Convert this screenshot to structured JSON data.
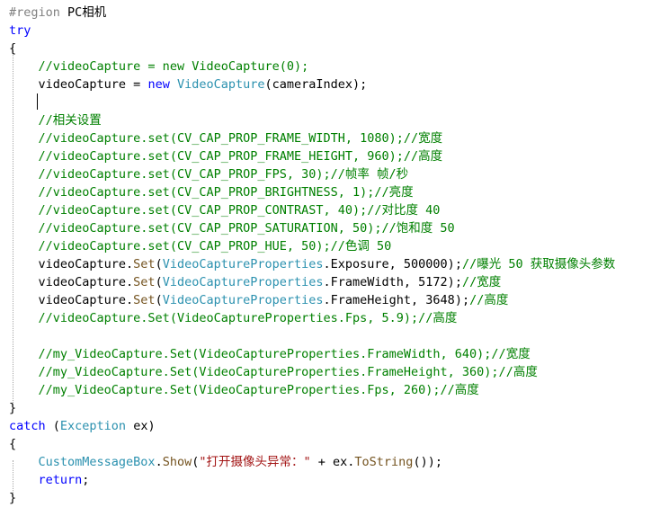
{
  "editor": {
    "lines": [
      [
        {
          "t": "#region ",
          "c": "directive"
        },
        {
          "t": "PC相机",
          "c": "plain"
        }
      ],
      [
        {
          "t": "try",
          "c": "kw"
        }
      ],
      [
        {
          "t": "{",
          "c": "plain"
        }
      ],
      [
        {
          "t": "    ",
          "c": "plain"
        },
        {
          "t": "//videoCapture = new VideoCapture(0);",
          "c": "comment"
        }
      ],
      [
        {
          "t": "    videoCapture = ",
          "c": "plain"
        },
        {
          "t": "new",
          "c": "kw"
        },
        {
          "t": " ",
          "c": "plain"
        },
        {
          "t": "VideoCapture",
          "c": "type"
        },
        {
          "t": "(cameraIndex);",
          "c": "plain"
        }
      ],
      [
        {
          "t": "",
          "c": "plain"
        }
      ],
      [
        {
          "t": "    ",
          "c": "plain"
        },
        {
          "t": "//相关设置",
          "c": "comment"
        }
      ],
      [
        {
          "t": "    ",
          "c": "plain"
        },
        {
          "t": "//videoCapture.set(CV_CAP_PROP_FRAME_WIDTH, 1080);//宽度",
          "c": "comment"
        }
      ],
      [
        {
          "t": "    ",
          "c": "plain"
        },
        {
          "t": "//videoCapture.set(CV_CAP_PROP_FRAME_HEIGHT, 960);//高度",
          "c": "comment"
        }
      ],
      [
        {
          "t": "    ",
          "c": "plain"
        },
        {
          "t": "//videoCapture.set(CV_CAP_PROP_FPS, 30);//帧率 帧/秒",
          "c": "comment"
        }
      ],
      [
        {
          "t": "    ",
          "c": "plain"
        },
        {
          "t": "//videoCapture.set(CV_CAP_PROP_BRIGHTNESS, 1);//亮度",
          "c": "comment"
        }
      ],
      [
        {
          "t": "    ",
          "c": "plain"
        },
        {
          "t": "//videoCapture.set(CV_CAP_PROP_CONTRAST, 40);//对比度 40",
          "c": "comment"
        }
      ],
      [
        {
          "t": "    ",
          "c": "plain"
        },
        {
          "t": "//videoCapture.set(CV_CAP_PROP_SATURATION, 50);//饱和度 50",
          "c": "comment"
        }
      ],
      [
        {
          "t": "    ",
          "c": "plain"
        },
        {
          "t": "//videoCapture.set(CV_CAP_PROP_HUE, 50);//色调 50",
          "c": "comment"
        }
      ],
      [
        {
          "t": "    videoCapture.",
          "c": "plain"
        },
        {
          "t": "Set",
          "c": "method"
        },
        {
          "t": "(",
          "c": "plain"
        },
        {
          "t": "VideoCaptureProperties",
          "c": "type"
        },
        {
          "t": ".Exposure, 500000);",
          "c": "plain"
        },
        {
          "t": "//曝光 50 获取摄像头参数",
          "c": "comment"
        }
      ],
      [
        {
          "t": "    videoCapture.",
          "c": "plain"
        },
        {
          "t": "Set",
          "c": "method"
        },
        {
          "t": "(",
          "c": "plain"
        },
        {
          "t": "VideoCaptureProperties",
          "c": "type"
        },
        {
          "t": ".FrameWidth, 5172);",
          "c": "plain"
        },
        {
          "t": "//宽度",
          "c": "comment"
        }
      ],
      [
        {
          "t": "    videoCapture.",
          "c": "plain"
        },
        {
          "t": "Set",
          "c": "method"
        },
        {
          "t": "(",
          "c": "plain"
        },
        {
          "t": "VideoCaptureProperties",
          "c": "type"
        },
        {
          "t": ".FrameHeight, 3648);",
          "c": "plain"
        },
        {
          "t": "//高度",
          "c": "comment"
        }
      ],
      [
        {
          "t": "    ",
          "c": "plain"
        },
        {
          "t": "//videoCapture.Set(VideoCaptureProperties.Fps, 5.9);//高度",
          "c": "comment"
        }
      ],
      [
        {
          "t": "",
          "c": "plain"
        }
      ],
      [
        {
          "t": "    ",
          "c": "plain"
        },
        {
          "t": "//my_VideoCapture.Set(VideoCaptureProperties.FrameWidth, 640);//宽度",
          "c": "comment"
        }
      ],
      [
        {
          "t": "    ",
          "c": "plain"
        },
        {
          "t": "//my_VideoCapture.Set(VideoCaptureProperties.FrameHeight, 360);//高度",
          "c": "comment"
        }
      ],
      [
        {
          "t": "    ",
          "c": "plain"
        },
        {
          "t": "//my_VideoCapture.Set(VideoCaptureProperties.Fps, 260);//高度",
          "c": "comment"
        }
      ],
      [
        {
          "t": "}",
          "c": "plain"
        }
      ],
      [
        {
          "t": "catch",
          "c": "kw"
        },
        {
          "t": " (",
          "c": "plain"
        },
        {
          "t": "Exception",
          "c": "type"
        },
        {
          "t": " ex)",
          "c": "plain"
        }
      ],
      [
        {
          "t": "{",
          "c": "plain"
        }
      ],
      [
        {
          "t": "    ",
          "c": "plain"
        },
        {
          "t": "CustomMessageBox",
          "c": "type"
        },
        {
          "t": ".",
          "c": "plain"
        },
        {
          "t": "Show",
          "c": "method"
        },
        {
          "t": "(",
          "c": "plain"
        },
        {
          "t": "\"打开摄像头异常：\"",
          "c": "string"
        },
        {
          "t": " + ex.",
          "c": "plain"
        },
        {
          "t": "ToString",
          "c": "method"
        },
        {
          "t": "());",
          "c": "plain"
        }
      ],
      [
        {
          "t": "    ",
          "c": "plain"
        },
        {
          "t": "return",
          "c": "kw"
        },
        {
          "t": ";",
          "c": "plain"
        }
      ],
      [
        {
          "t": "}",
          "c": "plain"
        }
      ]
    ]
  }
}
